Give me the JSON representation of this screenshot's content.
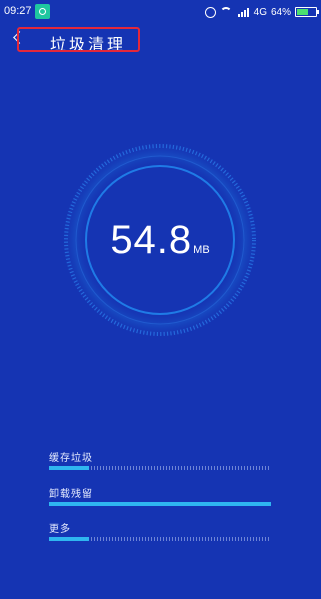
{
  "status_bar": {
    "time": "09:27",
    "app_icon": "scan-app-icon",
    "alarm_icon": "alarm-icon",
    "wifi_icon": "wifi-icon",
    "signal_icon": "signal-icon",
    "network": "4G",
    "battery_text": "64%",
    "battery_level": 0.64,
    "battery_color": "#4be06f"
  },
  "header": {
    "back_icon": "back-chevron-icon",
    "title": "垃圾清理",
    "highlight_color": "#e5283a"
  },
  "gauge": {
    "value": "54.8",
    "unit": "MB",
    "ring_color": "#1f7be6"
  },
  "categories": [
    {
      "label": "缓存垃圾",
      "progress": 0.18
    },
    {
      "label": "卸载残留",
      "progress": 1.0
    },
    {
      "label": "更多",
      "progress": 0.18
    }
  ],
  "colors": {
    "background": "#1534b3",
    "progress_fill": "#2fb6f0"
  }
}
